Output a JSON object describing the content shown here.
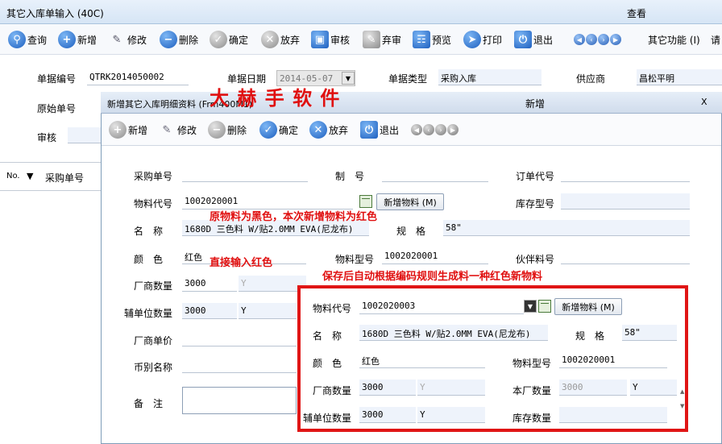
{
  "window": {
    "title": "其它入库单输入 (40C)",
    "view_label": "查看"
  },
  "main_toolbar": {
    "query": "查询",
    "new": "新增",
    "edit": "修改",
    "delete": "删除",
    "confirm": "确定",
    "abandon": "放弃",
    "audit": "审核",
    "unaudit": "弃审",
    "preview": "预览",
    "print": "打印",
    "exit": "退出",
    "other": "其它功能 (I)",
    "req": "请"
  },
  "header_form": {
    "doc_no_label": "单据编号",
    "doc_no": "QTRK2014050002",
    "doc_date_label": "单据日期",
    "doc_date": "2014-05-07",
    "doc_type_label": "单据类型",
    "doc_type": "采购入库",
    "supplier_label": "供应商",
    "supplier": "昌松平明",
    "orig_no_label": "原始单号",
    "audit_label": "审核"
  },
  "grid": {
    "no_col": "No.",
    "purchase_col": "采购单号"
  },
  "dialog": {
    "title": "新增其它入库明细资料 (Frm400M1)",
    "mode": "新增",
    "close": "X",
    "toolbar": {
      "new": "新增",
      "edit": "修改",
      "delete": "删除",
      "confirm": "确定",
      "abandon": "放弃",
      "exit": "退出"
    },
    "form": {
      "po_label": "采购单号",
      "mfg_label": "制　号",
      "order_code_label": "订单代号",
      "mat_code_label": "物料代号",
      "mat_code": "1002020001",
      "add_mat_btn": "新增物料 (M)",
      "stock_model_label": "库存型号",
      "name_label": "名　称",
      "name": "1680D 三色料 W/贴2.0MM EVA(尼龙布)",
      "spec_label": "规　格",
      "spec": "58\"",
      "color_label": "颜　色",
      "color": "红色",
      "mat_model_label": "物料型号",
      "mat_model": "1002020001",
      "partner_label": "伙伴料号",
      "vendor_qty_label": "厂商数量",
      "vendor_qty": "3000",
      "vendor_qty_unit": "Y",
      "factory_qty_label": "本厂数量",
      "factory_qty": "3000",
      "aux_qty_label": "辅单位数量",
      "aux_qty": "3000",
      "aux_qty_unit": "Y",
      "vendor_price_label": "厂商单价",
      "currency_label": "币别名称",
      "remark_label": "备　注"
    }
  },
  "popup": {
    "mat_code_label": "物料代号",
    "mat_code": "1002020003",
    "add_mat_btn": "新增物料 (M)",
    "name_label": "名　称",
    "name": "1680D 三色料 W/贴2.0MM EVA(尼龙布)",
    "spec_label": "规　格",
    "spec": "58\"",
    "color_label": "颜　色",
    "color": "红色",
    "mat_model_label": "物料型号",
    "mat_model": "1002020001",
    "vendor_qty_label": "厂商数量",
    "vendor_qty": "3000",
    "vendor_qty_unit": "Y",
    "factory_qty_label": "本厂数量",
    "factory_qty": "3000",
    "factory_qty_unit": "Y",
    "aux_qty_label": "辅单位数量",
    "aux_qty": "3000",
    "aux_qty_unit": "Y",
    "stock_qty_label": "库存数量"
  },
  "annotations": {
    "brand": "大 赫 手 软 件",
    "note1": "原物料为黑色，本次新增物料为红色",
    "note2": "直接输入红色",
    "note3": "保存后自动根据编码规则生成料一种红色新物料"
  },
  "colors": {
    "annotation": "#e01010",
    "accent": "#1d5fbf"
  }
}
